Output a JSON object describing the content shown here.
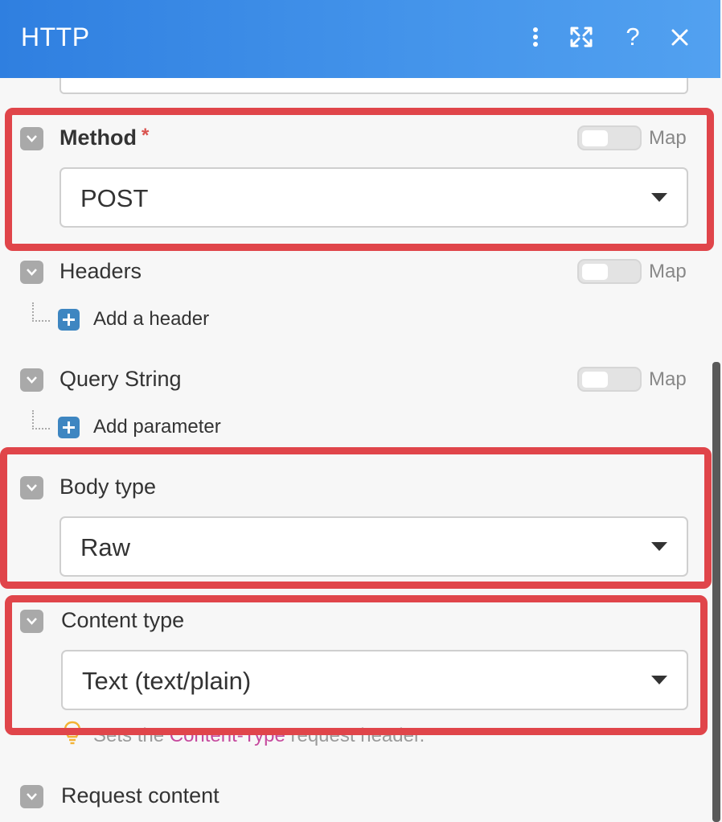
{
  "window": {
    "title": "HTTP",
    "icons": [
      "more-vertical-icon",
      "expand-icon",
      "help-icon",
      "close-icon"
    ],
    "help_glyph": "?",
    "accent_color": "#3f8fe8"
  },
  "fields": {
    "method": {
      "label": "Method",
      "required_mark": "*",
      "map_label": "Map",
      "value": "POST",
      "map_enabled": false
    },
    "headers": {
      "label": "Headers",
      "map_label": "Map",
      "add_label": "Add a header",
      "map_enabled": false
    },
    "query_string": {
      "label": "Query String",
      "map_label": "Map",
      "add_label": "Add parameter",
      "map_enabled": false
    },
    "body_type": {
      "label": "Body type",
      "value": "Raw"
    },
    "content_type": {
      "label": "Content type",
      "value": "Text (text/plain)",
      "hint_prefix": "Sets the ",
      "hint_code": "Content-Type",
      "hint_suffix": " request header."
    },
    "request_content": {
      "label": "Request content"
    }
  },
  "highlight_color": "#e0454a"
}
